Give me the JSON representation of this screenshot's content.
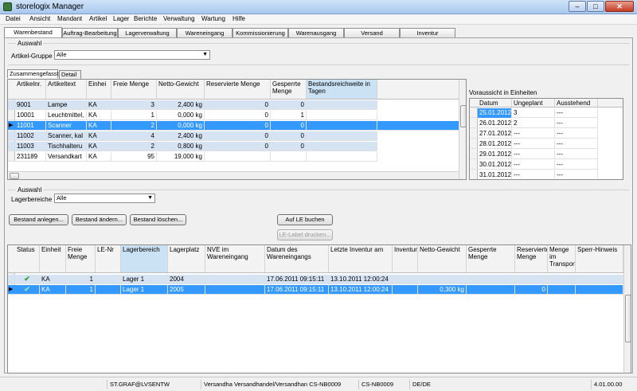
{
  "window": {
    "title": "storelogix Manager",
    "minimize": "–",
    "maximize": "□",
    "close": "✕"
  },
  "menu": [
    "Datei",
    "Ansicht",
    "Mandant",
    "Artikel",
    "Lager",
    "Berichte",
    "Verwaltung",
    "Wartung",
    "Hilfe"
  ],
  "tabs": [
    "Warenbestand",
    "Auftrag-Bearbeitung",
    "Lagerverwaltung",
    "Wareneingang",
    "Kommissionierung",
    "Warenausgang",
    "Versand",
    "Inventur"
  ],
  "auswahl_top": {
    "label": "Auswahl",
    "field_label": "Artikel-Gruppe",
    "value": "Alle"
  },
  "subtabs": [
    "Zusammengefasst",
    "Detail"
  ],
  "summary_grid": {
    "headers": [
      "Artikelnr.",
      "Artikeltext",
      "Einhei",
      "Freie Menge",
      "Netto-Gewicht",
      "Reservierte Menge",
      "Gesperrte Menge",
      "Bestandsreichweite in Tagen"
    ],
    "rows": [
      [
        "9001",
        "Lampe",
        "KA",
        "3",
        "2,400 kg",
        "0",
        "0",
        ""
      ],
      [
        "10001",
        "Leuchtmittel,",
        "KA",
        "1",
        "0,000 kg",
        "0",
        "1",
        ""
      ],
      [
        "11001",
        "Scanner",
        "KA",
        "2",
        "0,000 kg",
        "0",
        "0",
        ""
      ],
      [
        "11002",
        "Scanner, kal",
        "KA",
        "4",
        "2,400 kg",
        "0",
        "0",
        ""
      ],
      [
        "11003",
        "Tischhalteru",
        "KA",
        "2",
        "0,800 kg",
        "0",
        "0",
        ""
      ],
      [
        "231189",
        "Versandkart",
        "KA",
        "95",
        "19,000 kg",
        "",
        "",
        ""
      ]
    ]
  },
  "forecast": {
    "title": "Voraussicht in Einheiten",
    "headers": [
      "Datum",
      "Ungeplant",
      "Ausstehend"
    ],
    "rows": [
      [
        "25.01.2012",
        "3",
        "---"
      ],
      [
        "26.01.2012",
        "2",
        "---"
      ],
      [
        "27.01.2012",
        "---",
        "---"
      ],
      [
        "28.01.2012",
        "---",
        "---"
      ],
      [
        "29.01.2012",
        "---",
        "---"
      ],
      [
        "30.01.2012",
        "---",
        "---"
      ],
      [
        "31.01.2012",
        "---",
        "---"
      ]
    ]
  },
  "auswahl_bottom": {
    "label": "Auswahl",
    "field_label": "Lagerbereiche",
    "value": "Alle"
  },
  "buttons": {
    "bestand_anlegen": "Bestand anlegen...",
    "bestand_aendern": "Bestand ändern...",
    "bestand_loeschen": "Bestand löschen...",
    "auf_le_buchen": "Auf LE buchen",
    "le_label_drucken": "LE-Label drucken..."
  },
  "detail_grid": {
    "headers": [
      "Status",
      "Einheit",
      "Freie Menge",
      "LE-Nr",
      "Lagerbereich",
      "Lagerplatz",
      "NVE im Wareneingang",
      "Datum des Wareneingangs",
      "Letzte Inventur am",
      "Inventur",
      "Netto-Gewicht",
      "Gesperrte Menge",
      "Reservierte Menge",
      "Menge im Transpor",
      "Sperr-Hinweis"
    ],
    "rows": [
      [
        "✔",
        "KA",
        "1",
        "",
        "Lager 1",
        "2004",
        "",
        "17.06.2011 09:15:11",
        "13.10.2011 12:00:24",
        "",
        "",
        "",
        "",
        "",
        ""
      ],
      [
        "✔",
        "KA",
        "1",
        "",
        "Lager 1",
        "2005",
        "",
        "17.06.2011 09:15:11",
        "13.10.2011 12:00:24",
        "",
        "0,300 kg",
        "",
        "0",
        "",
        ""
      ]
    ]
  },
  "status": {
    "user": "ST.GRAF@LVSENTW",
    "client": "Versandha  Versandhandel/Versandhan  CS-NB0009",
    "host": "CS-NB0009",
    "lang": "DE/DE",
    "version": "4.01.00.00"
  }
}
